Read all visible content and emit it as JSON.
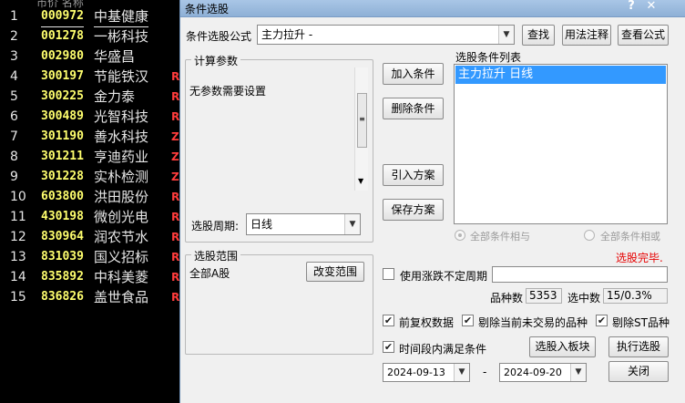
{
  "stock_list": {
    "partial_top_text": "市价 名称",
    "rows": [
      {
        "num": "1",
        "code": "000972",
        "name": "中基健康",
        "flag": ""
      },
      {
        "num": "2",
        "code": "001278",
        "name": "一彬科技",
        "flag": ""
      },
      {
        "num": "3",
        "code": "002980",
        "name": "华盛昌",
        "flag": ""
      },
      {
        "num": "4",
        "code": "300197",
        "name": "节能铁汉",
        "flag": "R"
      },
      {
        "num": "5",
        "code": "300225",
        "name": "金力泰",
        "flag": "R"
      },
      {
        "num": "6",
        "code": "300489",
        "name": "光智科技",
        "flag": "R"
      },
      {
        "num": "7",
        "code": "301190",
        "name": "善水科技",
        "flag": "Z"
      },
      {
        "num": "8",
        "code": "301211",
        "name": "亨迪药业",
        "flag": "Z"
      },
      {
        "num": "9",
        "code": "301228",
        "name": "实朴检测",
        "flag": "Z"
      },
      {
        "num": "10",
        "code": "603800",
        "name": "洪田股份",
        "flag": "R"
      },
      {
        "num": "11",
        "code": "430198",
        "name": "微创光电",
        "flag": "R"
      },
      {
        "num": "12",
        "code": "830964",
        "name": "润农节水",
        "flag": "R"
      },
      {
        "num": "13",
        "code": "831039",
        "name": "国义招标",
        "flag": "R"
      },
      {
        "num": "14",
        "code": "835892",
        "name": "中科美菱",
        "flag": "R"
      },
      {
        "num": "15",
        "code": "836826",
        "name": "盖世食品",
        "flag": "R"
      }
    ]
  },
  "dialog": {
    "title": "条件选股",
    "help_symbol": "?",
    "close_symbol": "✕",
    "formula_label": "条件选股公式",
    "formula_value": "主力拉升      -",
    "buttons": {
      "find": "查找",
      "usage": "用法注释",
      "view_formula": "查看公式",
      "add_condition": "加入条件",
      "delete_condition": "删除条件",
      "import_plan": "引入方案",
      "save_plan": "保存方案",
      "change_range": "改变范围",
      "pick_to_board": "选股入板块",
      "execute": "执行选股",
      "close": "关闭"
    },
    "params_group": {
      "title": "计算参数",
      "text": "无参数需要设置"
    },
    "period_label": "选股周期:",
    "period_value": "日线",
    "conditions_list": {
      "title": "选股条件列表",
      "items": [
        "主力拉升  日线"
      ]
    },
    "logic": {
      "and_label": "全部条件相与",
      "or_label": "全部条件相或"
    },
    "status": "选股完毕.",
    "status_color": "#e60000",
    "range_group": {
      "title": "选股范围",
      "value": "全部A股"
    },
    "variable_period_label": "使用涨跌不定周期",
    "variable_period_value": "",
    "count_label": "品种数",
    "count_value": "5353",
    "selected_label": "选中数",
    "selected_value": "15/0.3%",
    "checks": {
      "prior_adj": "前复权数据",
      "exclude_untraded": "剔除当前未交易的品种",
      "exclude_st": "剔除ST品种",
      "time_range": "时间段内满足条件"
    },
    "date_from": "2024-09-13",
    "date_to": "2024-09-20",
    "date_sep": "-"
  }
}
